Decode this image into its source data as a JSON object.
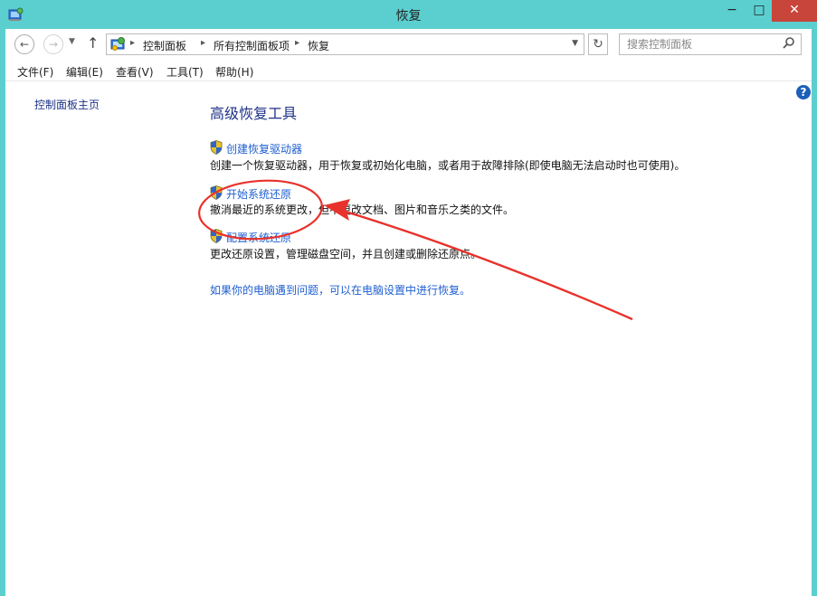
{
  "window": {
    "title": "恢复"
  },
  "window_controls": {
    "minimize": "−",
    "maximize": "□",
    "close": "✕"
  },
  "address": {
    "crumbs": [
      "控制面板",
      "所有控制面板项",
      "恢复"
    ],
    "separator": "▸"
  },
  "search": {
    "placeholder": "搜索控制面板"
  },
  "menu": [
    "文件(F)",
    "编辑(E)",
    "查看(V)",
    "工具(T)",
    "帮助(H)"
  ],
  "sidebar": {
    "home_label": "控制面板主页"
  },
  "help": {
    "glyph": "?"
  },
  "main": {
    "heading": "高级恢复工具",
    "tools": [
      {
        "title": "创建恢复驱动器",
        "description": "创建一个恢复驱动器，用于恢复或初始化电脑，或者用于故障排除(即使电脑无法启动时也可使用)。"
      },
      {
        "title": "开始系统还原",
        "description": "撤消最近的系统更改，但不更改文档、图片和音乐之类的文件。"
      },
      {
        "title": "配置系统还原",
        "description": "更改还原设置，管理磁盘空间，并且创建或删除还原点。"
      }
    ],
    "footer_link": "如果你的电脑遇到问题，可以在电脑设置中进行恢复。"
  },
  "annotation": {
    "color": "#e8322b"
  },
  "icons": {
    "shield": "uac-shield-icon",
    "control_panel": "control-panel-icon"
  }
}
